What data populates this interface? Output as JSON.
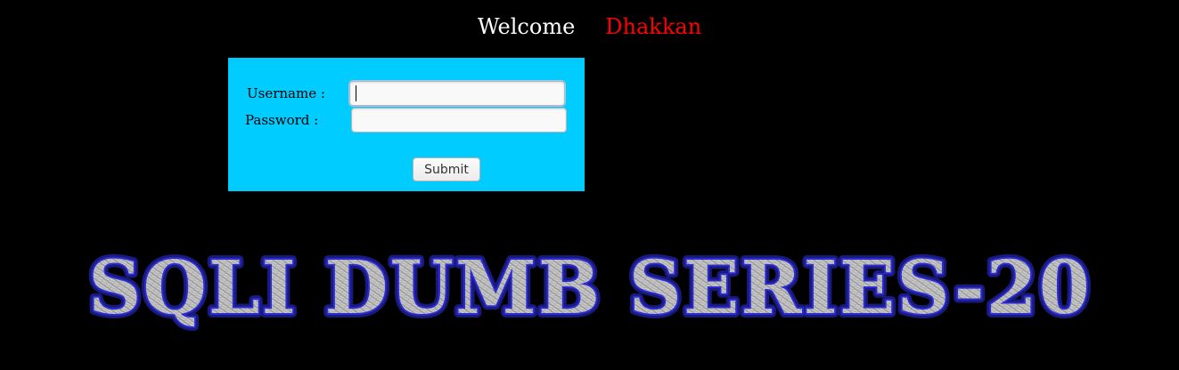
{
  "header": {
    "welcome_text": "Welcome",
    "user_name": "Dhakkan"
  },
  "login_form": {
    "username_label": "Username :",
    "password_label": "Password :",
    "username_value": "",
    "password_value": "",
    "submit_label": "Submit"
  },
  "banner": {
    "title": "SQLI DUMB SERIES-20"
  },
  "colors": {
    "page_background": "#000000",
    "panel_background": "#00ccff",
    "welcome_text": "#ffffff",
    "user_name": "#ff0000",
    "banner_outline": "#2b2bd6"
  }
}
